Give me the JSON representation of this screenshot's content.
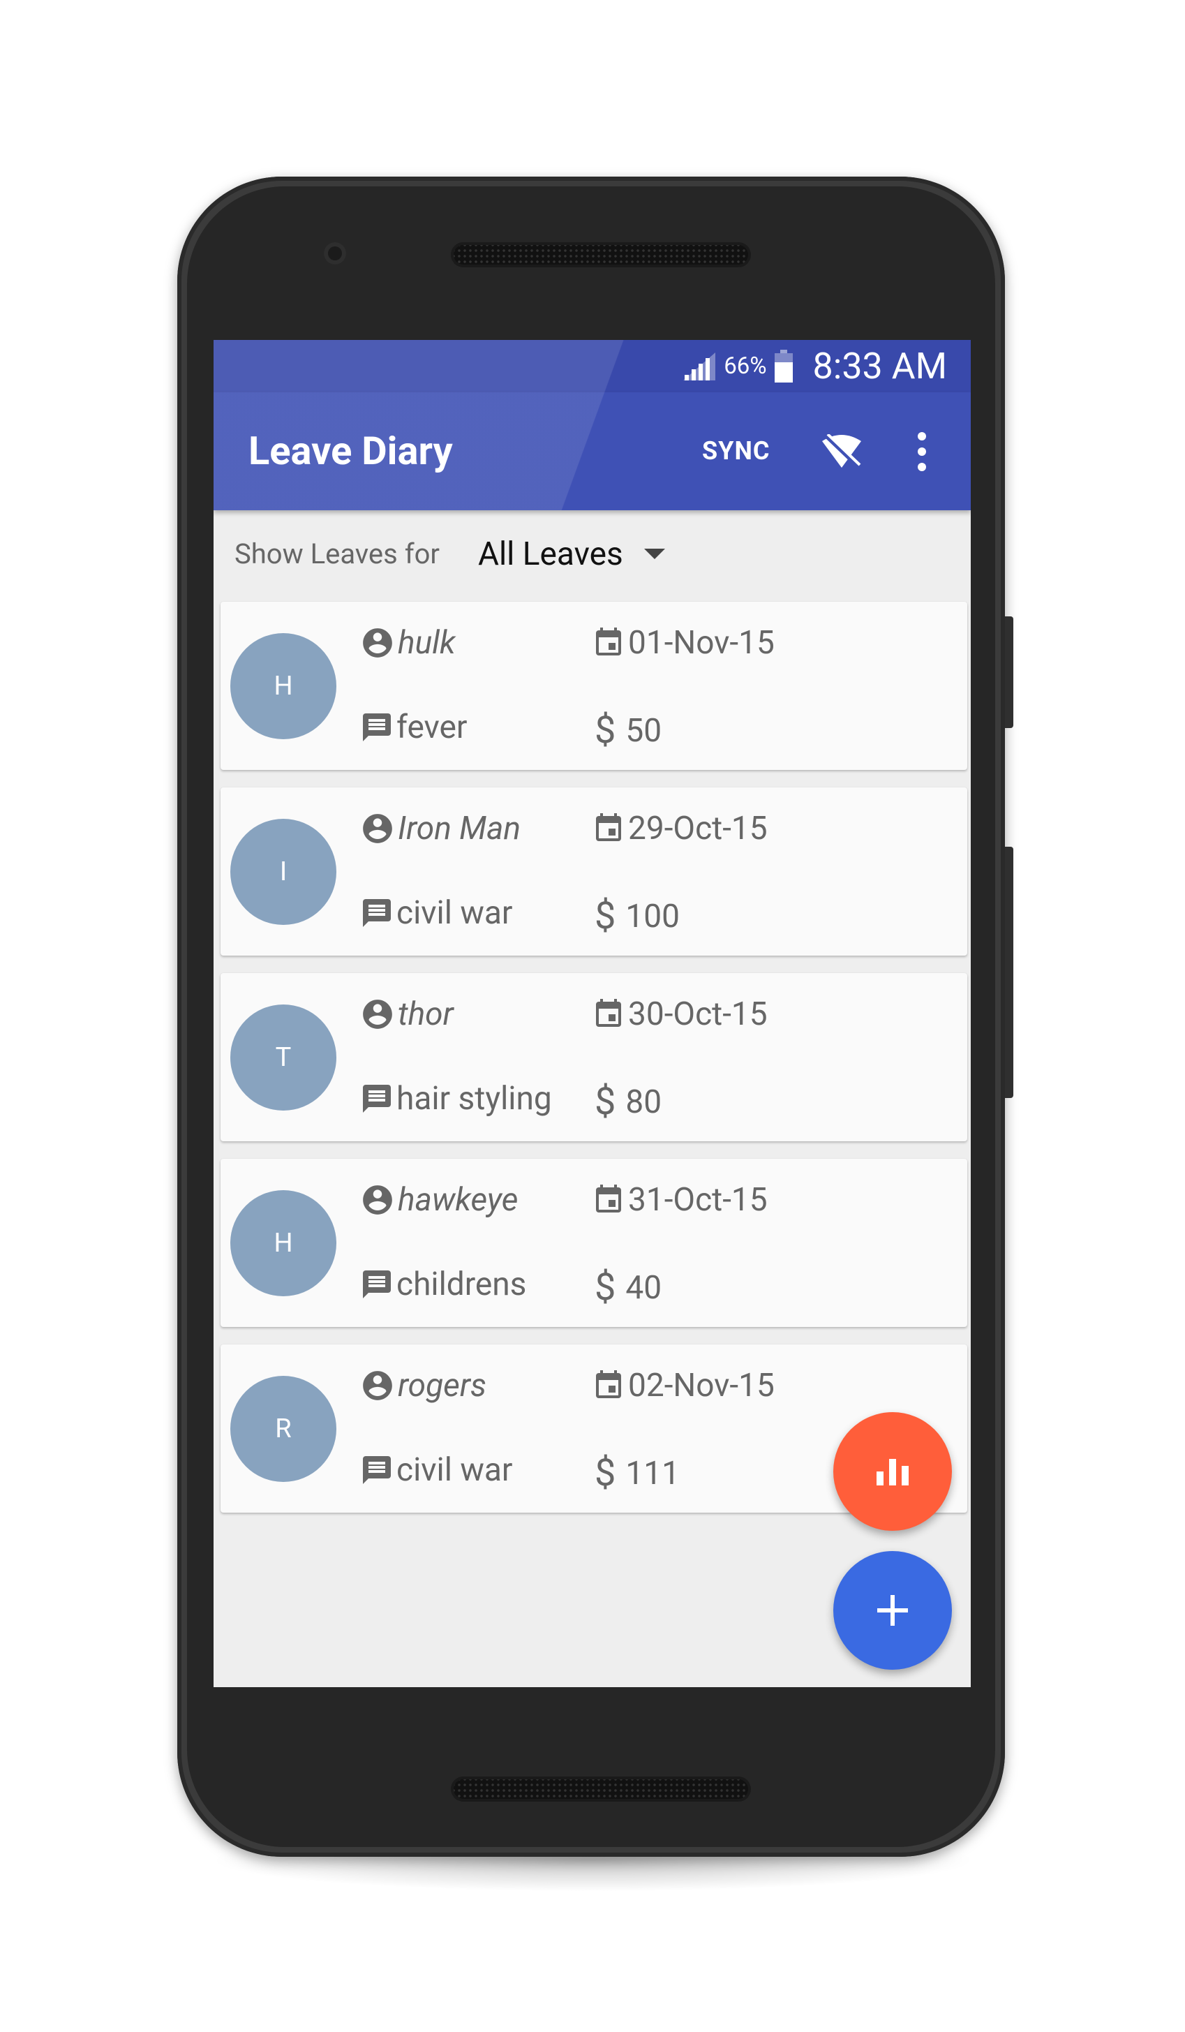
{
  "status_bar": {
    "battery_percent": "66%",
    "time": "8:33 AM"
  },
  "app_bar": {
    "title": "Leave Diary",
    "sync_label": "SYNC"
  },
  "filter": {
    "label": "Show Leaves for",
    "selected": "All Leaves"
  },
  "leaves": [
    {
      "initial": "H",
      "name": "hulk",
      "date": "01-Nov-15",
      "reason": "fever",
      "currency": "$",
      "amount": "50"
    },
    {
      "initial": "I",
      "name": "Iron Man",
      "date": "29-Oct-15",
      "reason": "civil war",
      "currency": "$",
      "amount": "100"
    },
    {
      "initial": "T",
      "name": "thor",
      "date": "30-Oct-15",
      "reason": "hair styling",
      "currency": "$",
      "amount": "80"
    },
    {
      "initial": "H",
      "name": "hawkeye",
      "date": "31-Oct-15",
      "reason": "childrens",
      "currency": "$",
      "amount": "40"
    },
    {
      "initial": "R",
      "name": "rogers",
      "date": "02-Nov-15",
      "reason": "civil war",
      "currency": "$",
      "amount": "111"
    }
  ],
  "icons": {
    "status": [
      "signal-icon",
      "battery-icon"
    ],
    "app_bar": [
      "wifi-off-icon",
      "more-vert-icon"
    ],
    "card": [
      "account-circle-icon",
      "calendar-icon",
      "message-icon"
    ],
    "fabs": [
      "bar-chart-icon",
      "plus-icon"
    ]
  },
  "colors": {
    "primary": "#3f51b5",
    "primary_dark": "#3949ab",
    "avatar": "#88a3bf",
    "fab_stats": "#ff5e3a",
    "fab_add": "#3a6ae2"
  }
}
